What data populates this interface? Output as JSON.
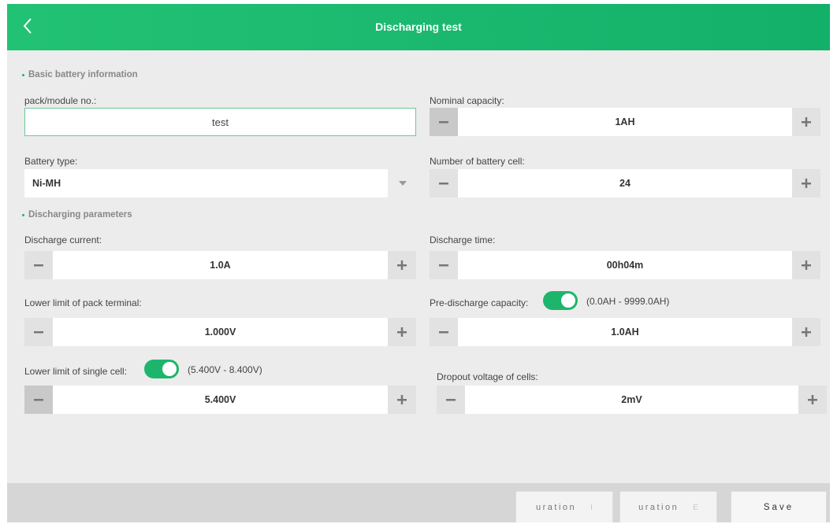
{
  "header": {
    "title": "Discharging test"
  },
  "sections": {
    "basic": "Basic battery information",
    "discharging": "Discharging parameters"
  },
  "fields": {
    "pack_no": {
      "label": "pack/module no.:",
      "value": "test"
    },
    "nominal_capacity": {
      "label": "Nominal capacity:",
      "value": "1AH"
    },
    "battery_type": {
      "label": "Battery type:",
      "value": "Ni-MH"
    },
    "cell_count": {
      "label": "Number of battery cell:",
      "value": "24"
    },
    "discharge_current": {
      "label": "Discharge current:",
      "value": "1.0A"
    },
    "discharge_time": {
      "label": "Discharge time:",
      "value": "00h04m"
    },
    "lower_limit_pack": {
      "label": "Lower limit of pack terminal:",
      "value": "1.000V"
    },
    "pre_discharge": {
      "label": "Pre-discharge capacity:",
      "value": "1.0AH",
      "range": "(0.0AH - 9999.0AH)",
      "toggle_on": true
    },
    "lower_limit_cell": {
      "label": "Lower limit of single cell:",
      "value": "5.400V",
      "range": "(5.400V - 8.400V)",
      "toggle_on": true
    },
    "dropout_voltage": {
      "label": "Dropout voltage of cells:",
      "value": "2mV"
    }
  },
  "footer": {
    "btn1_label": "uration",
    "btn1_faded": "I",
    "btn2_label": "uration",
    "btn2_faded": "E",
    "save_label": "Save"
  },
  "colors": {
    "accent": "#1db56c",
    "header_start": "#22c274",
    "header_end": "#13b06a",
    "background": "#ececec"
  },
  "icons": {
    "back": "chevron-left-icon",
    "minus": "minus-icon",
    "plus": "plus-icon",
    "dropdown": "caret-down-icon"
  }
}
